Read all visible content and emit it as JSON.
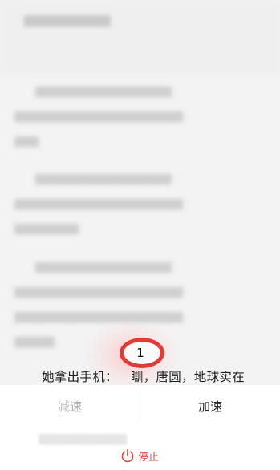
{
  "reader": {
    "visible_line_start": "她拿出手机：",
    "visible_line_end": "瞓，唐圆，地球实在"
  },
  "counter": {
    "value": "1"
  },
  "controls": {
    "slow_label": "减速",
    "fast_label": "加速",
    "stop_label": "停止"
  },
  "colors": {
    "accent": "#e23b36",
    "stop": "#e2483f",
    "disabled": "#b3b3b3"
  },
  "icons": {
    "stop": "power-icon"
  }
}
